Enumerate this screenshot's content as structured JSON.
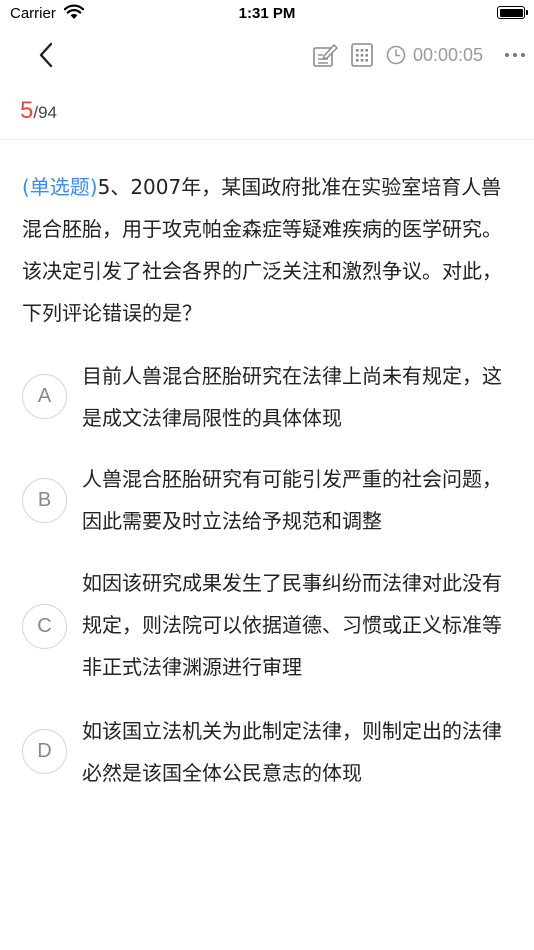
{
  "status_bar": {
    "carrier": "Carrier",
    "time": "1:31 PM"
  },
  "toolbar": {
    "timer": "00:00:05"
  },
  "progress": {
    "current": "5",
    "total": "/94"
  },
  "question": {
    "type_label": "(单选题)",
    "text": "5、2007年，某国政府批准在实验室培育人兽混合胚胎，用于攻克帕金森症等疑难疾病的医学研究。该决定引发了社会各界的广泛关注和激烈争议。对此，下列评论错误的是？"
  },
  "options": [
    {
      "letter": "A",
      "text": "目前人兽混合胚胎研究在法律上尚未有规定，这是成文法律局限性的具体体现"
    },
    {
      "letter": "B",
      "text": "人兽混合胚胎研究有可能引发严重的社会问题，因此需要及时立法给予规范和调整"
    },
    {
      "letter": "C",
      "text": "如因该研究成果发生了民事纠纷而法律对此没有规定，则法院可以依据道德、习惯或正义标准等非正式法律渊源进行审理"
    },
    {
      "letter": "D",
      "text": "如该国立法机关为此制定法律，则制定出的法律必然是该国全体公民意志的体现"
    }
  ],
  "colors": {
    "progress_current": "#e8473b",
    "question_type": "#3a8ee6",
    "icon_gray": "#9a9a9a"
  },
  "icons": [
    "back-chevron",
    "wifi",
    "battery",
    "note-edit",
    "answer-sheet-grid",
    "clock",
    "more-dots"
  ]
}
